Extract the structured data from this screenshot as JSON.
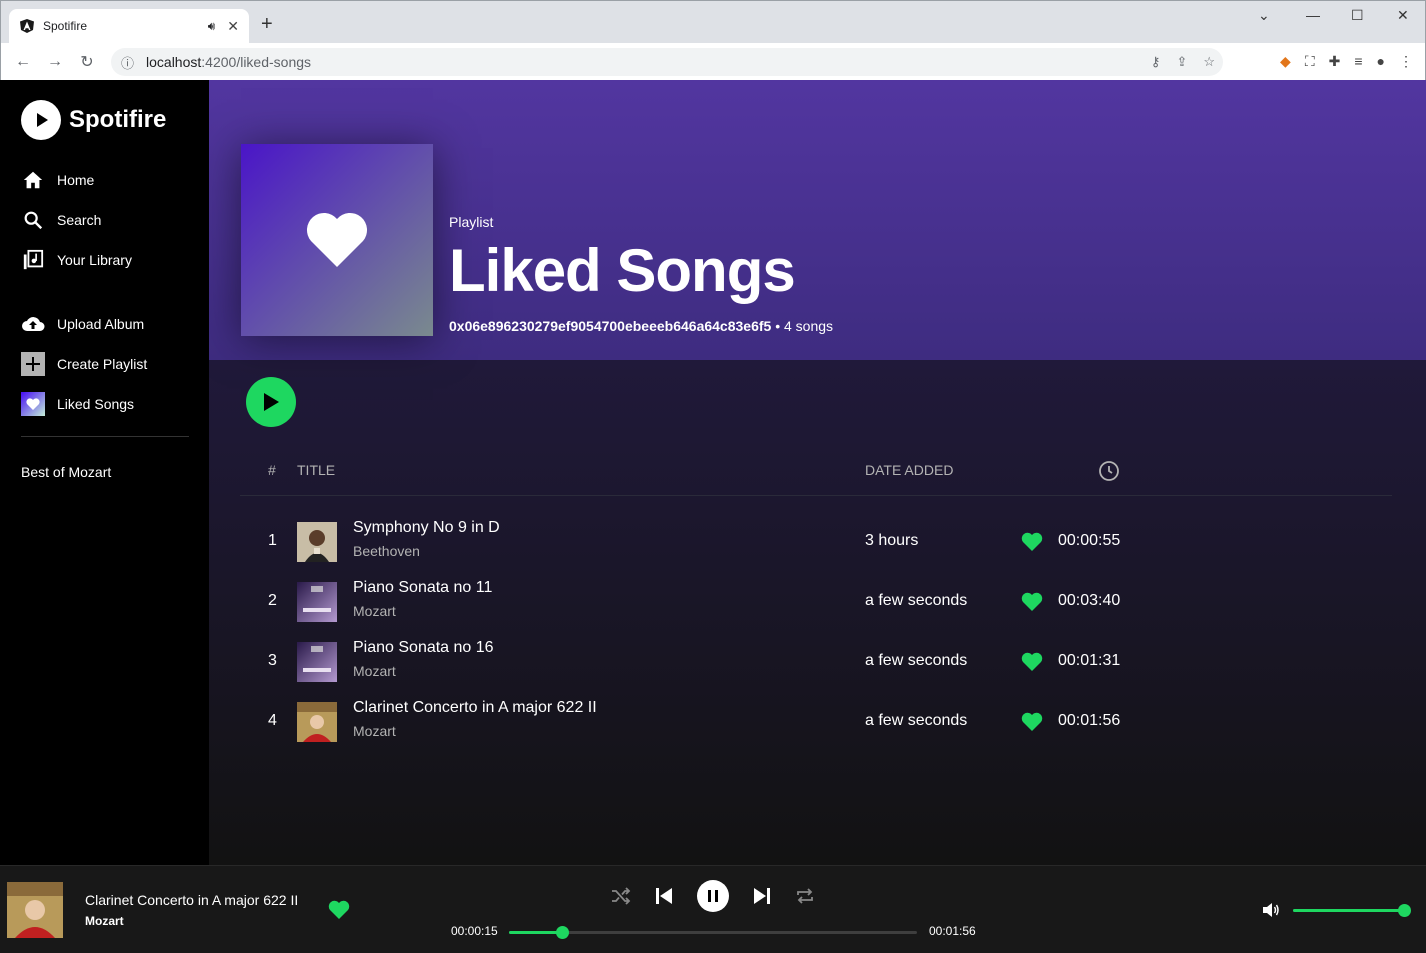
{
  "browser": {
    "tab_title": "Spotifire",
    "url_host": "localhost",
    "url_rest": ":4200/liked-songs"
  },
  "sidebar": {
    "brand": "Spotifire",
    "nav": [
      {
        "label": "Home",
        "icon": "home-icon"
      },
      {
        "label": "Search",
        "icon": "search-icon"
      },
      {
        "label": "Your Library",
        "icon": "library-icon"
      }
    ],
    "actions": [
      {
        "label": "Upload Album",
        "icon": "cloud-upload-icon"
      },
      {
        "label": "Create Playlist",
        "icon": "plus-icon"
      },
      {
        "label": "Liked Songs",
        "icon": "heart-icon"
      }
    ],
    "playlists": [
      "Best of Mozart"
    ]
  },
  "hero": {
    "type": "Playlist",
    "title": "Liked Songs",
    "owner": "0x06e896230279ef9054700ebeeeb646a64c83e6f5",
    "separator": " • ",
    "count": "4 songs"
  },
  "table": {
    "headers": {
      "num": "#",
      "title": "TITLE",
      "date": "DATE ADDED",
      "duration": "clock-icon"
    },
    "rows": [
      {
        "num": "1",
        "title": "Symphony No 9 in D",
        "artist": "Beethoven",
        "date": "3 hours",
        "duration": "00:00:55"
      },
      {
        "num": "2",
        "title": "Piano Sonata no 11",
        "artist": "Mozart",
        "date": "a few seconds",
        "duration": "00:03:40"
      },
      {
        "num": "3",
        "title": "Piano Sonata no 16",
        "artist": "Mozart",
        "date": "a few seconds",
        "duration": "00:01:31"
      },
      {
        "num": "4",
        "title": "Clarinet Concerto in A major 622 II",
        "artist": "Mozart",
        "date": "a few seconds",
        "duration": "00:01:56"
      }
    ]
  },
  "player": {
    "title": "Clarinet Concerto in A major 622 II",
    "artist": "Mozart",
    "elapsed": "00:00:15",
    "total": "00:01:56",
    "progress": 0.13,
    "volume": 1.0,
    "is_playing": true
  },
  "colors": {
    "accent": "#1ed760",
    "hero_top": "#5236a0",
    "background": "#121212"
  }
}
